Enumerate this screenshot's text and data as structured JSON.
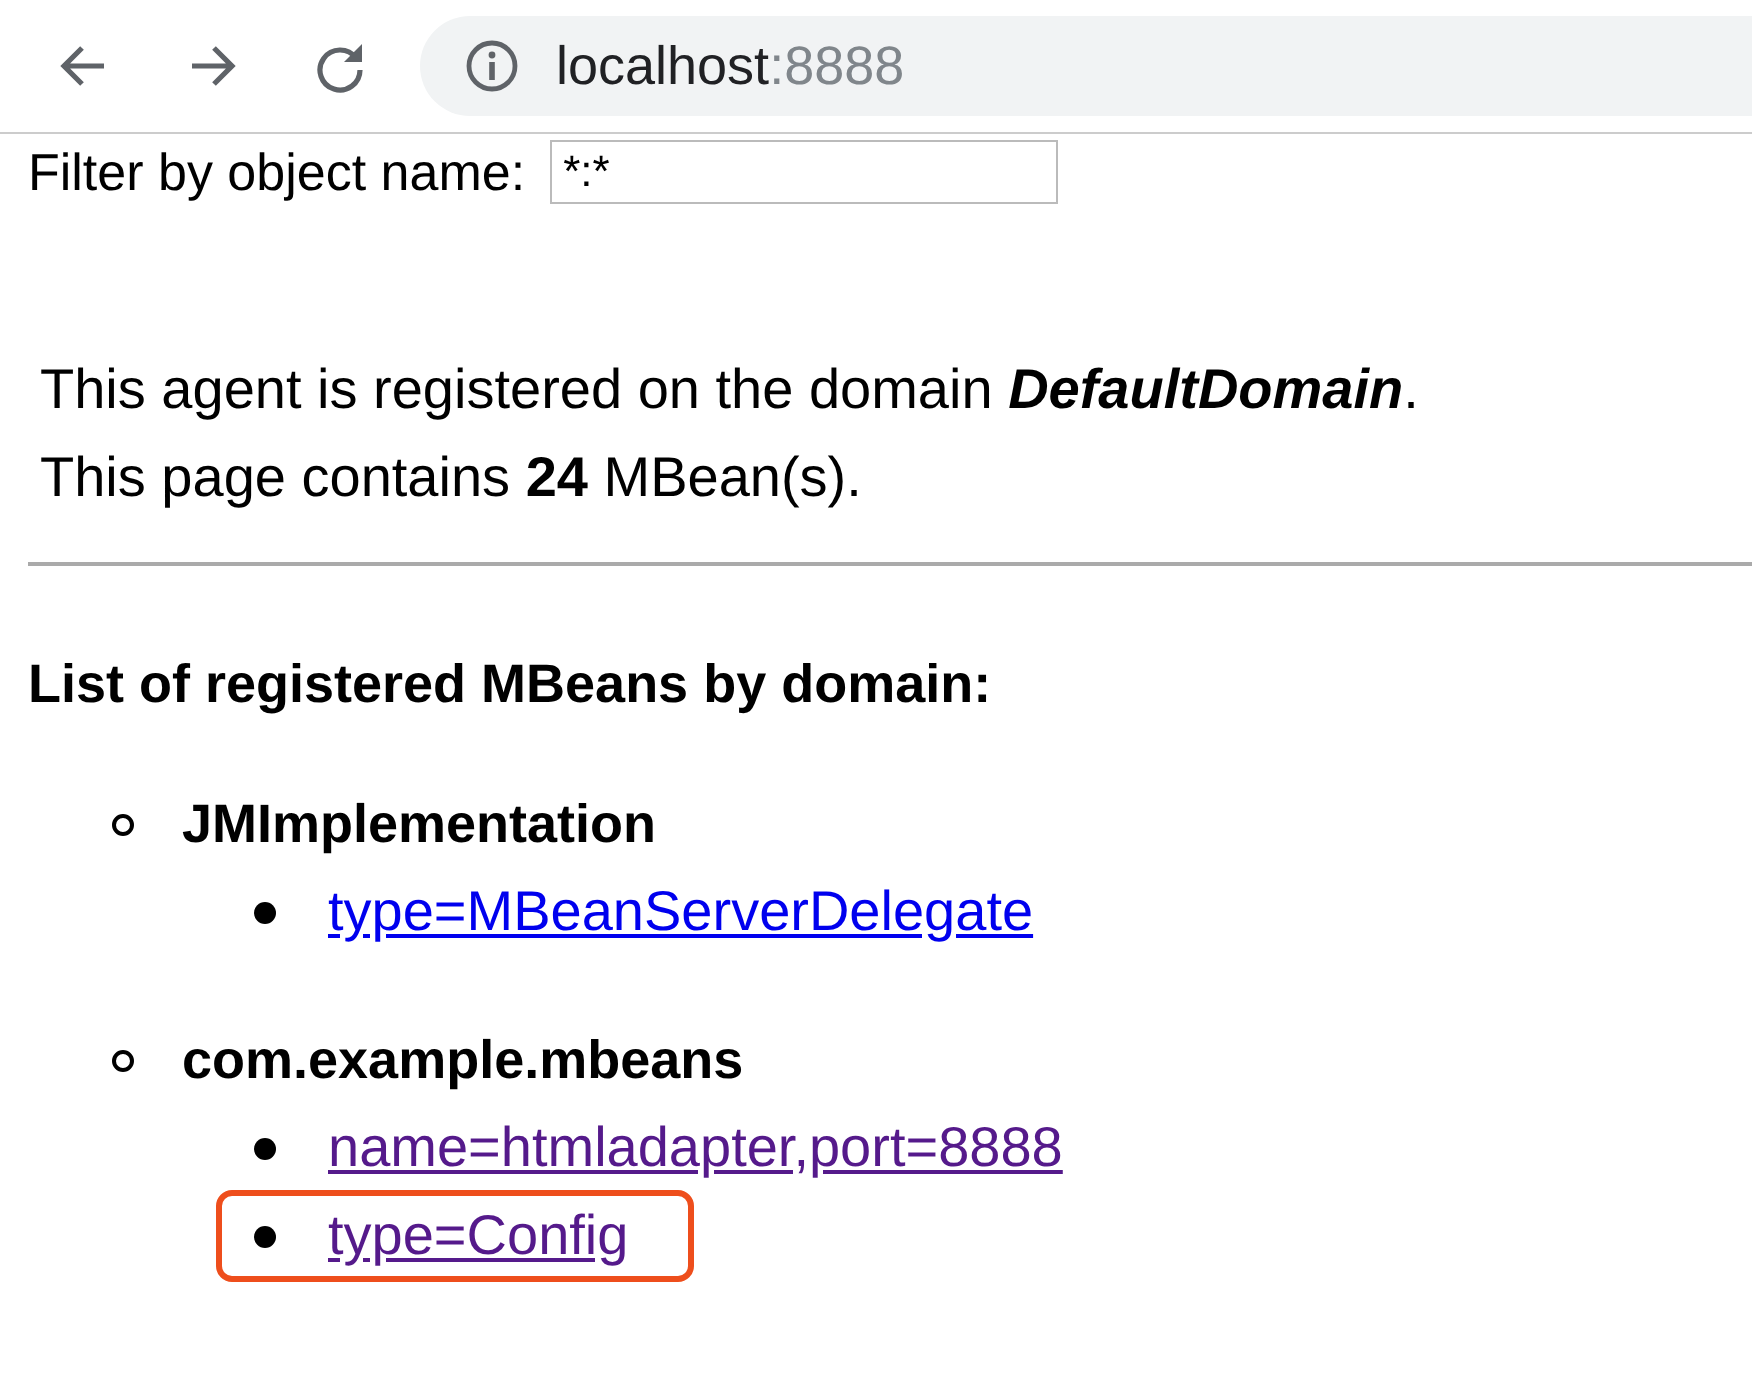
{
  "toolbar": {
    "url_host": "localhost",
    "url_port": ":8888"
  },
  "filter": {
    "label": "Filter by object name:",
    "value": "*:*"
  },
  "info": [
    "This agent is registered on the domain *DefaultDomain*.",
    "This page contains **24** MBean(s)."
  ],
  "heading": "List of registered MBeans by domain:",
  "domains": [
    {
      "name": "JMImplementation",
      "mbeans": [
        {
          "label": "type=MBeanServerDelegate",
          "visited": false,
          "highlighted": false
        }
      ]
    },
    {
      "name": "com.example.mbeans",
      "mbeans": [
        {
          "label": "name=htmladapter,port=8888",
          "visited": true,
          "highlighted": false
        },
        {
          "label": "type=Config",
          "visited": true,
          "highlighted": true
        }
      ]
    }
  ]
}
